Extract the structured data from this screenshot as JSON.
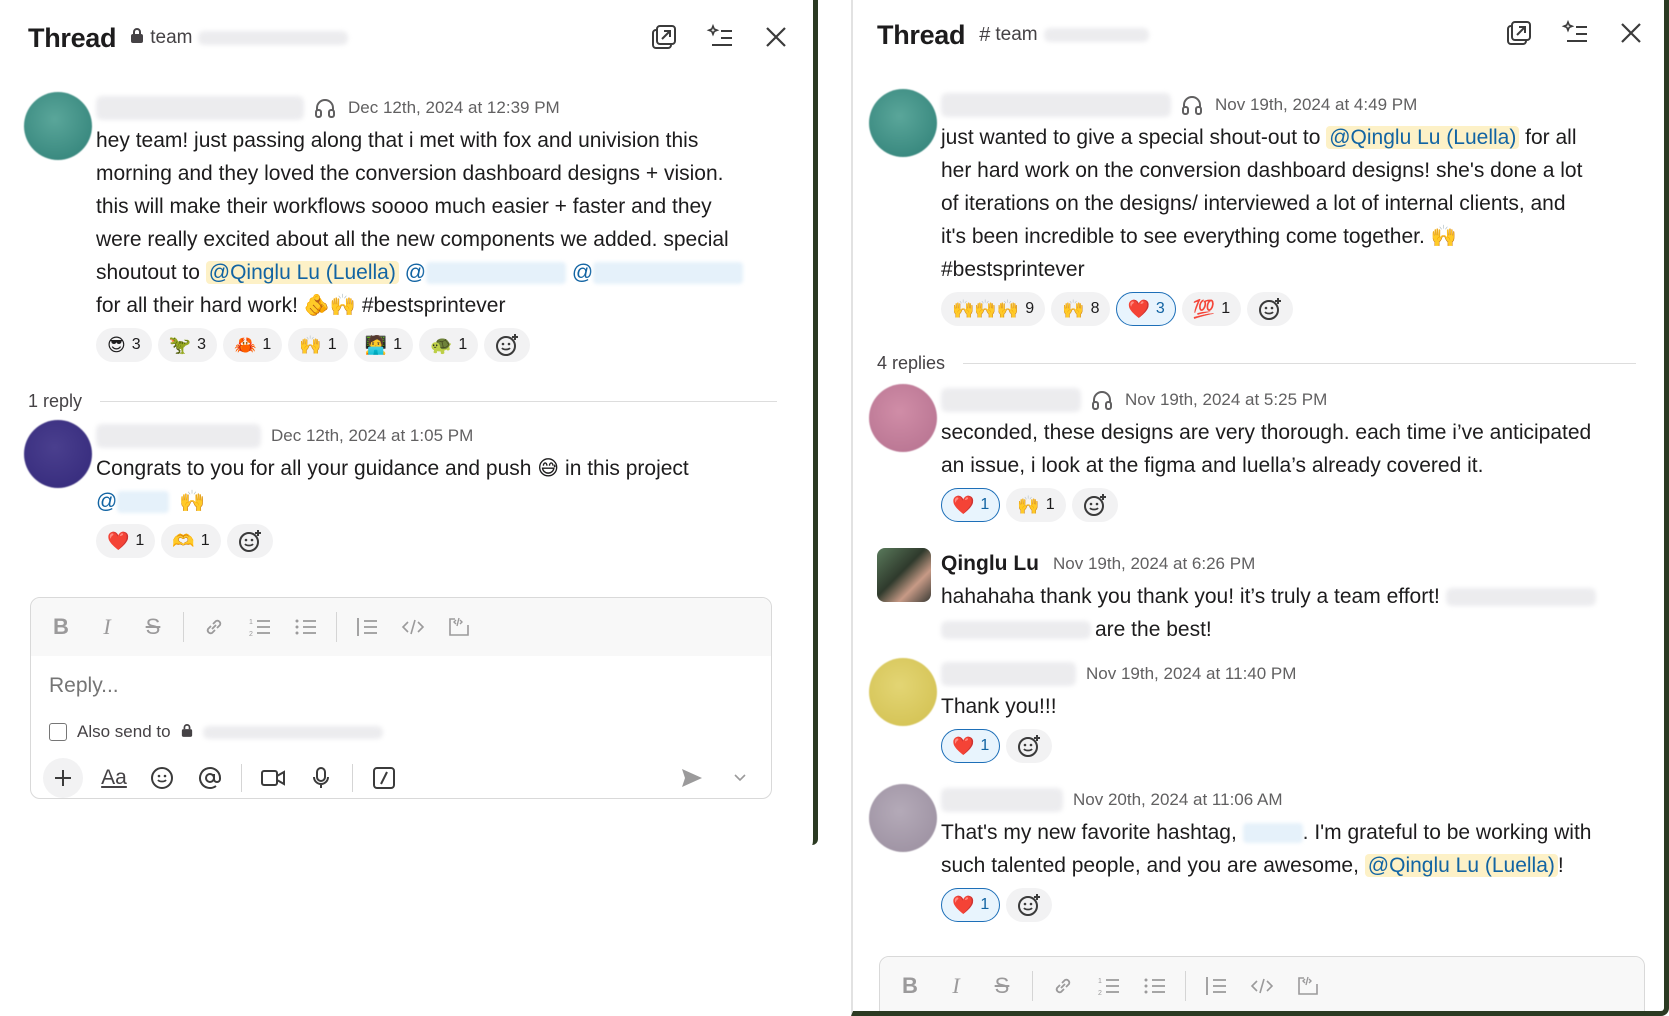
{
  "left": {
    "title": "Thread",
    "channel": "team",
    "messages": [
      {
        "time": "Dec 12th, 2024 at 12:39 PM",
        "lines": [
          "hey team! just passing along that i met with fox and univision this",
          "morning and they loved the conversion dashboard designs + vision.",
          "this will make their workflows soooo much easier + faster and they",
          "were really excited about all the new components we added. special"
        ],
        "line5_prefix": "shoutout to ",
        "mention": "@Qinglu Lu (Luella)",
        "at1": "@",
        "at2": "@",
        "line6_text": "for all their hard work! ",
        "line6_emoji": "🫵🙌",
        "line6_hashtag": " #bestsprintever",
        "reactions": [
          {
            "emoji": "😎",
            "count": "3"
          },
          {
            "emoji": "🦖",
            "count": "3"
          },
          {
            "emoji": "🦀",
            "count": "1"
          },
          {
            "emoji": "🙌",
            "count": "1"
          },
          {
            "emoji": "🧑‍💻",
            "count": "1"
          },
          {
            "emoji": "🐢",
            "count": "1"
          }
        ]
      },
      {
        "time": "Dec 12th, 2024 at 1:05 PM",
        "text_a": "Congrats to you for all your guidance and push ",
        "emoji_a": "😅",
        "text_b": " in this project",
        "at": "@",
        "emoji_b": "🙌",
        "reactions": [
          {
            "emoji": "❤️",
            "count": "1"
          },
          {
            "emoji": "🫶",
            "count": "1"
          }
        ]
      }
    ],
    "replies_label": "1 reply",
    "composer": {
      "placeholder": "Reply...",
      "also_send": "Also send to"
    }
  },
  "right": {
    "title": "Thread",
    "channel": "team",
    "parent": {
      "time": "Nov 19th, 2024 at 4:49 PM",
      "prefix": "just wanted to give a special shout-out to ",
      "mention": "@Qinglu Lu (Luella)",
      "suffix": " for all",
      "lines": [
        "her hard work on the conversion dashboard designs! she's done a lot",
        "of iterations on the designs/ interviewed a lot of internal clients, and"
      ],
      "line4": "it's been incredible to see everything come together. ",
      "line4_emoji": "🙌",
      "hashtag": "#bestsprintever",
      "reactions": [
        {
          "emoji": "🙌🙌🙌",
          "count": "9",
          "active": false
        },
        {
          "emoji": "🙌",
          "count": "8",
          "active": false
        },
        {
          "emoji": "❤️",
          "count": "3",
          "active": true
        },
        {
          "emoji": "💯",
          "count": "1",
          "active": false
        }
      ]
    },
    "replies_label": "4 replies",
    "replies": [
      {
        "time": "Nov 19th, 2024 at 5:25 PM",
        "lines": [
          "seconded, these designs are very thorough. each time i’ve anticipated",
          "an issue, i look at the figma and luella’s already covered it."
        ],
        "reactions": [
          {
            "emoji": "❤️",
            "count": "1",
            "active": true
          },
          {
            "emoji": "🙌",
            "count": "1",
            "active": false
          }
        ]
      },
      {
        "name": "Qinglu Lu",
        "time": "Nov 19th, 2024 at 6:26 PM",
        "line1": "hahahaha thank you thank you! it’s truly a team effort!",
        "line2": "are the best!"
      },
      {
        "time": "Nov 19th, 2024 at 11:40 PM",
        "text": "Thank you!!!",
        "reactions": [
          {
            "emoji": "❤️",
            "count": "1",
            "active": true
          }
        ]
      },
      {
        "time": "Nov 20th, 2024 at 11:06 AM",
        "line1_a": "That's my new favorite hashtag, ",
        "line1_b": ". I'm grateful to be working with",
        "line2_a": "such talented people, and you are awesome, ",
        "mention": "@Qinglu Lu (Luella)",
        "line2_b": "!",
        "reactions": [
          {
            "emoji": "❤️",
            "count": "1",
            "active": true
          }
        ]
      }
    ]
  },
  "colors": {
    "accent": "#1264a3",
    "mention_bg": "#fdf1c7",
    "panel_border": "#2b3a22",
    "reaction_active_border": "#1d6fb8"
  }
}
